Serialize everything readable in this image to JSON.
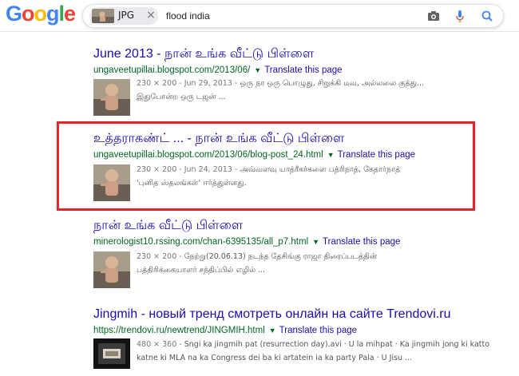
{
  "logo": {
    "letters": [
      "G",
      "o",
      "o",
      "g",
      "l",
      "e"
    ]
  },
  "search": {
    "chip_label": "JPG",
    "chip_close": "×",
    "query": "flood india"
  },
  "icons": {
    "camera": "camera-icon",
    "mic": "mic-icon",
    "search": "search-icon"
  },
  "colors": {
    "link": "#1a0dab",
    "url": "#006621",
    "snippet": "#545454",
    "highlight": "#e8212b"
  },
  "results": [
    {
      "title": "June 2013 - நான் உங்க வீட்டு பிள்ளை",
      "url": "ungaveetupillai.blogspot.com/2013/06/",
      "translate": "Translate this page",
      "meta": "230 × 200 - Jun 29, 2013 - ",
      "snippet1": "ஒரு நா ஒரு பொழுது, சிறுக்கி மவ, அல்லலை குத்து...",
      "snippet2": "இதுபோன்ற ஒரு டஜன் ..."
    },
    {
      "title": "உத்தராகண்ட் ... - நான் உங்க வீட்டு பிள்ளை",
      "url": "ungaveetupillai.blogspot.com/2013/06/blog-post_24.html",
      "translate": "Translate this page",
      "meta": "230 × 200 - Jun 24, 2013 - ",
      "snippet1": "அவ்வளவு யாத்ரீகர்களை பத்ரிநாத், கேதார்நாத்",
      "snippet2": "'புனித ஸ்தலங்கள்' ஈர்த்துள்ளது."
    },
    {
      "title": "நான் உங்க வீட்டு பிள்ளை",
      "url": "minerologist10.rssing.com/chan-6395135/all_p7.html",
      "translate": "Translate this page",
      "meta": "230 × 200 - ",
      "snippet1": "நேற்று(20.06.13) நடந்த தேசிங்கு ராஜா திரைப்படத்தின்",
      "snippet2": "பத்திரிக்கையாளர் சந்திப்பில் எழில் ..."
    },
    {
      "title": "Jingmih - новый тренд смотреть онлайн на сайте Trendovi.ru",
      "url": "https://trendovi.ru/newtrend/JINGMIH.html",
      "translate": "Translate this page",
      "meta": "480 × 360 - ",
      "snippet1": "Sngi ka jingmih pat (resurrection day).avi · U la mihpat · Ka jingmih jong ki katto",
      "snippet2": "katne ki MLA na ka Congress dei ba ki artatein ia ka party Pala · U Jisu ..."
    }
  ]
}
